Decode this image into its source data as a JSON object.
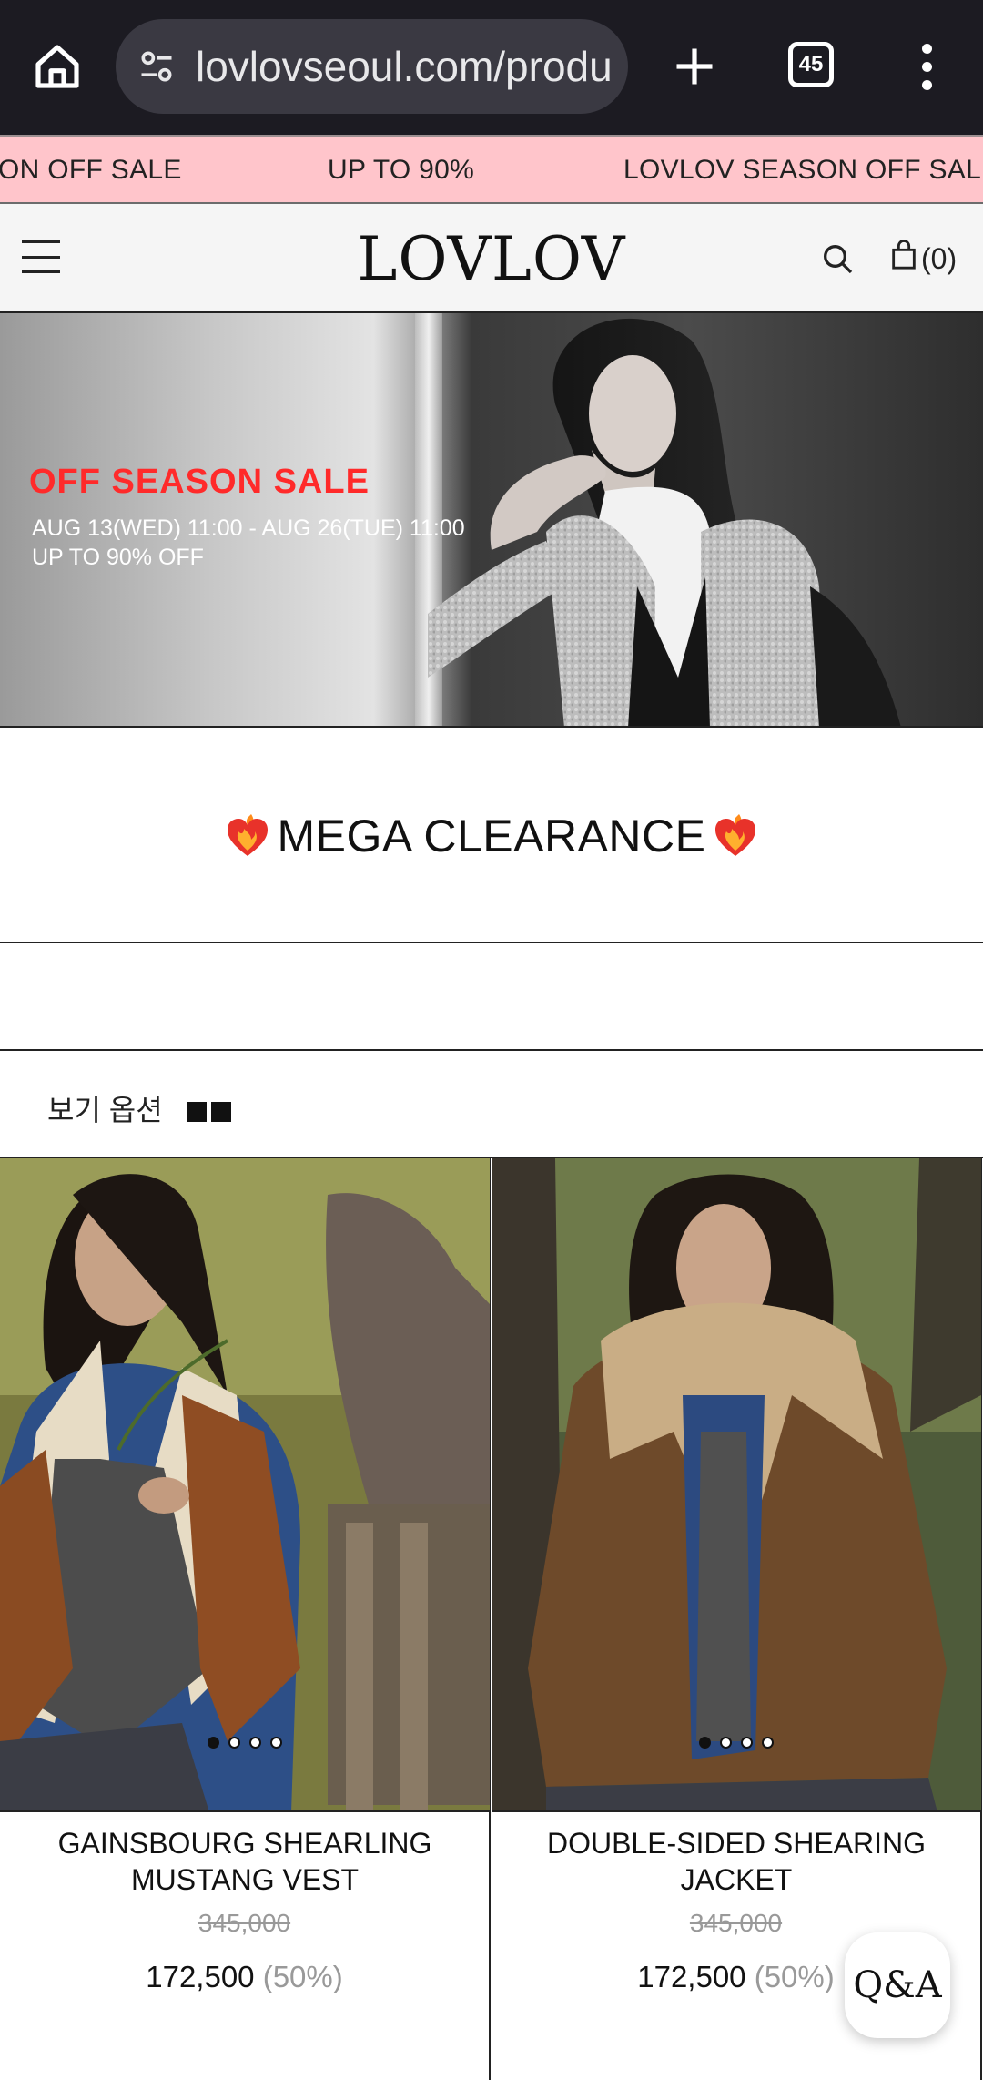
{
  "browser": {
    "url": "lovlovseoul.com/produ",
    "tab_count": "45"
  },
  "marquee": {
    "items": [
      "ON OFF SALE",
      "UP TO 90%",
      "LOVLOV SEASON OFF SALE"
    ]
  },
  "header": {
    "logo": "LOVLOV",
    "cart_count": "(0)"
  },
  "hero": {
    "title": "OFF SEASON SALE",
    "dates": "AUG 13(WED) 11:00 - AUG 26(TUE) 11:00",
    "discount": "UP TO 90% OFF"
  },
  "section": {
    "title": "MEGA CLEARANCE"
  },
  "view_options": {
    "label": "보기 옵션"
  },
  "products": [
    {
      "name_line1": "GAINSBOURG SHEARLING",
      "name_line2": "MUSTANG VEST",
      "original_price": "345,000",
      "sale_price": "172,500",
      "discount": "(50%)"
    },
    {
      "name_line1": "DOUBLE-SIDED SHEARING",
      "name_line2": "JACKET",
      "original_price": "345,000",
      "sale_price": "172,500",
      "discount": "(50%)"
    }
  ],
  "floating": {
    "qa_label": "Q&A"
  },
  "colors": {
    "chrome_bg": "#1c1b22",
    "marquee_bg": "#ffc5cb",
    "sale_red": "#ff2a2a",
    "muted_price": "#999999"
  },
  "icons": [
    "home-icon",
    "site-settings-icon",
    "new-tab-icon",
    "tab-switcher-icon",
    "more-menu-icon",
    "hamburger-menu-icon",
    "search-icon",
    "shopping-bag-icon",
    "heart-fire-emoji-icon"
  ]
}
